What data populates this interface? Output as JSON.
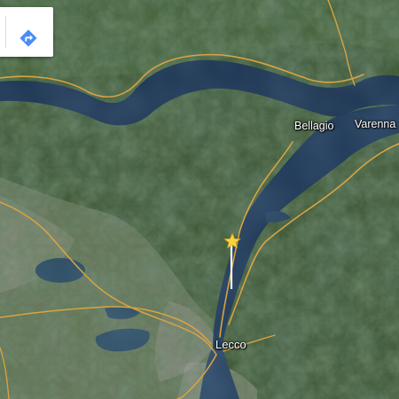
{
  "map": {
    "view": "satellite",
    "places": {
      "bellagio": "Bellagio",
      "varenna": "Varenna",
      "lecco": "Lecco"
    },
    "marker": "star-marker",
    "colors": {
      "lake": "#1b3350",
      "road": "#d9a441",
      "marker": "#f7d23a",
      "directions_button": "#4a8cf7"
    }
  },
  "controls": {
    "directions_icon": "directions-icon"
  }
}
